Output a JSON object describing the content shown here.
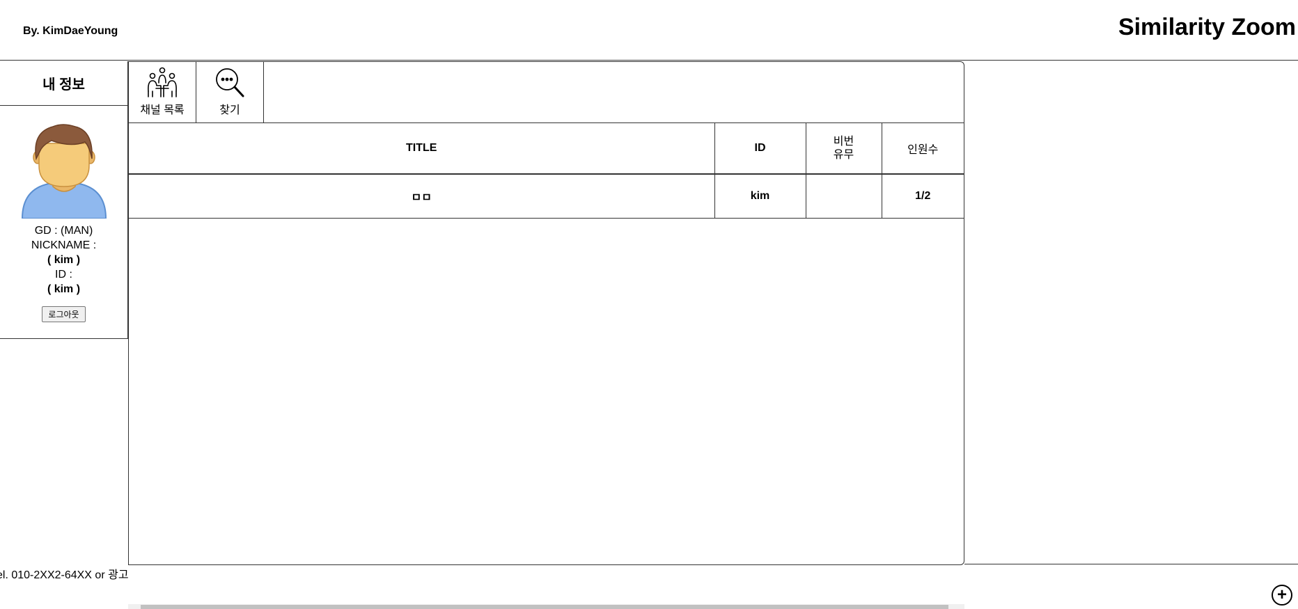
{
  "header": {
    "author": "By. KimDaeYoung",
    "title": "Similarity Zoom"
  },
  "sidebar": {
    "title": "내 정보",
    "avatar_icon": "user-avatar-icon",
    "gender_line": "GD : (MAN)",
    "nickname_label": "NICKNAME :",
    "nickname_value": "( kim )",
    "id_label": "ID :",
    "id_value": "( kim )",
    "logout_label": "로그아웃"
  },
  "toolbar": {
    "items": [
      {
        "label": "채널 목록",
        "icon": "people-meeting-icon"
      },
      {
        "label": "찾기",
        "icon": "search-more-icon"
      }
    ]
  },
  "table": {
    "headers": {
      "title": "TITLE",
      "id": "ID",
      "password_line1": "비번",
      "password_line2": "유무",
      "count": "인원수"
    },
    "rows": [
      {
        "title": "ㅁㅁ",
        "id": "kim",
        "password": "",
        "count": "1/2"
      }
    ]
  },
  "footer": {
    "text": "el. 010-2XX2-64XX or 광고",
    "add_button": "+"
  },
  "colors": {
    "border": "#333333",
    "avatar_hair": "#8b5a3c",
    "avatar_skin": "#f5cb7a",
    "avatar_shirt": "#8fb8ee"
  }
}
